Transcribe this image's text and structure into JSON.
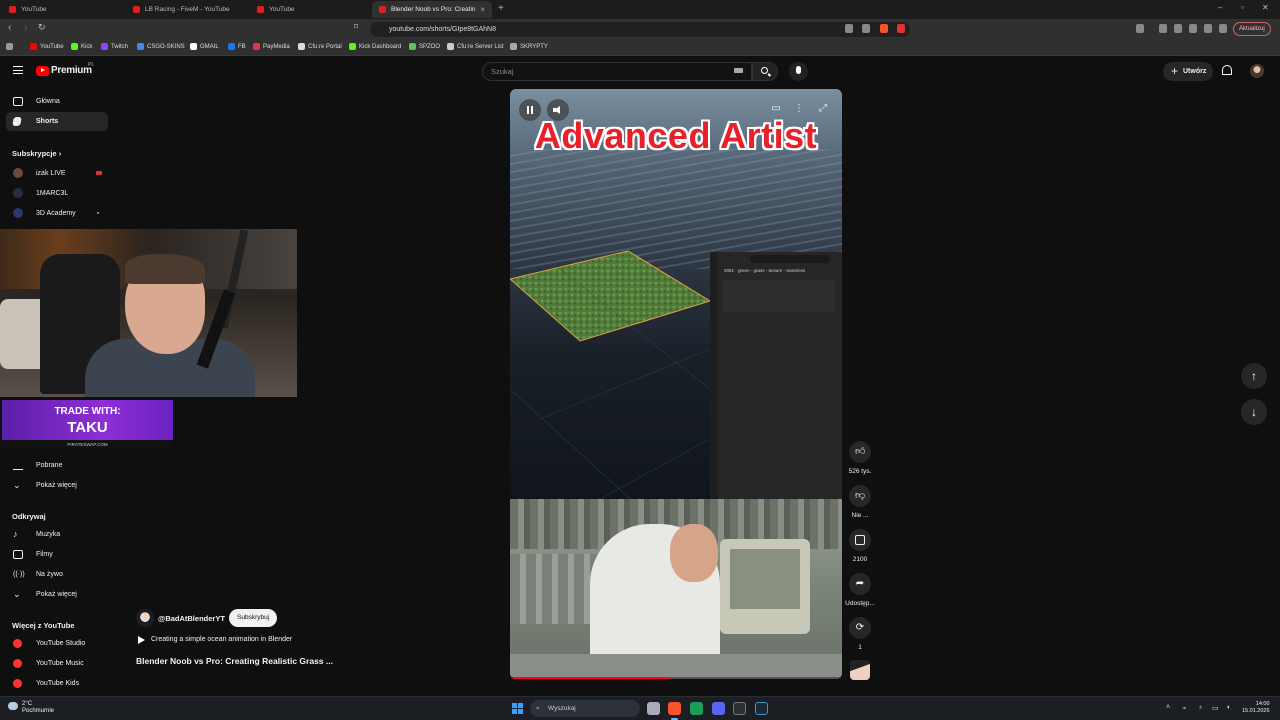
{
  "browser": {
    "tabs": [
      {
        "title": "YouTube",
        "active": false
      },
      {
        "title": "LB Racing - FiveM - YouTube",
        "active": false
      },
      {
        "title": "YouTube",
        "active": false
      },
      {
        "title": "Blender Noob vs Pro: Creatin",
        "active": true
      }
    ],
    "url": "youtube.com/shorts/GIpe8tGAhN8",
    "update_label": "Aktualizuj",
    "bookmarks": [
      {
        "label": "YouTube",
        "color": "#ff0000"
      },
      {
        "label": "Kick",
        "color": "#53fc18"
      },
      {
        "label": "Twitch",
        "color": "#9146ff"
      },
      {
        "label": "CSGO-SKINS",
        "color": "#3a8ee6"
      },
      {
        "label": "GMAIL",
        "color": "#ffffff"
      },
      {
        "label": "FB",
        "color": "#1877f2"
      },
      {
        "label": "PayMedia",
        "color": "#e2334a"
      },
      {
        "label": "Cfu:re Portal",
        "color": "#dddddd"
      },
      {
        "label": "Kick Dashboard",
        "color": "#53fc18"
      },
      {
        "label": "SPZOO",
        "color": "#5fbf5f"
      },
      {
        "label": "Cfu:re Server List",
        "color": "#cccccc"
      },
      {
        "label": "SKRYPTY",
        "color": "#aaaaaa"
      }
    ]
  },
  "header": {
    "logo_text": "Premium",
    "logo_region": "PL",
    "search_placeholder": "Szukaj",
    "create_label": "Utwórz"
  },
  "sidebar": {
    "top_items": [
      {
        "label": "Główna",
        "active": false
      },
      {
        "label": "Shorts",
        "active": true
      }
    ],
    "subscriptions_heading": "Subskrypcje",
    "subscriptions": [
      {
        "label": "izak LIVE",
        "live": true
      },
      {
        "label": "1MARC3L",
        "live": false
      },
      {
        "label": "3D Academy",
        "live": false
      }
    ],
    "you_items": [
      {
        "label": "Pobrane"
      },
      {
        "label": "Pokaż więcej"
      }
    ],
    "explore_heading": "Odkrywaj",
    "explore_items": [
      {
        "label": "Muzyka"
      },
      {
        "label": "Filmy"
      },
      {
        "label": "Na żywo"
      },
      {
        "label": "Pokaż więcej"
      }
    ],
    "more_heading": "Więcej z YouTube",
    "more_items": [
      {
        "label": "YouTube Studio"
      },
      {
        "label": "YouTube Music"
      },
      {
        "label": "YouTube Kids"
      }
    ]
  },
  "overlay": {
    "trade_line1": "TRADE WITH:",
    "trade_line2": "TAKU",
    "trade_site": "PIRATESWAP.COM"
  },
  "short": {
    "overlay_title": "Advanced Artist",
    "blender_file": "0081 - green - grass - texture - seamless",
    "progress": 0.48,
    "channel": "@BadAtBlenderYT",
    "subscribe_label": "Subskrybuj",
    "subtitle": "Creating a simple ocean animation in Blender",
    "title": "Blender Noob vs Pro: Creating Realistic Grass ..."
  },
  "actions": {
    "likes": "526 tys.",
    "dislike": "Nie ...",
    "comments": "2100",
    "share": "Udostęp...",
    "remix": "1"
  },
  "taskbar": {
    "temperature": "2°C",
    "weather": "Pochmurnie",
    "search_label": "Wyszukaj",
    "time": "14:00",
    "date": "15.01.2026"
  }
}
